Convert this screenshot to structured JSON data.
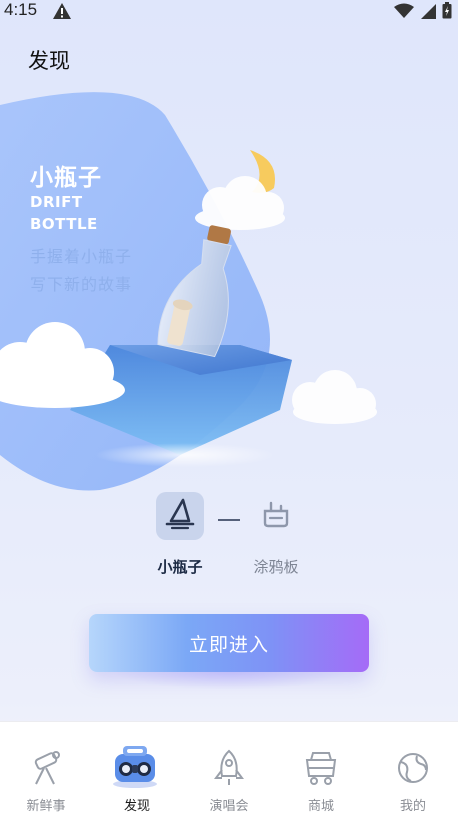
{
  "status_bar": {
    "time": "4:15",
    "icons": [
      "warning-icon",
      "wifi-icon",
      "signal-icon",
      "battery-icon"
    ]
  },
  "page": {
    "title": "发现"
  },
  "hero": {
    "title": "小瓶子",
    "en_line1": "DRIFT",
    "en_line2": "BOTTLE",
    "subtitle_line1": "手握着小瓶子",
    "subtitle_line2": "写下新的故事",
    "colors": {
      "blob": "#9fbdfa",
      "subtitle": "#8fb0ec"
    }
  },
  "modes": {
    "items": [
      {
        "label": "小瓶子",
        "icon": "bottle-sail-icon",
        "selected": true
      },
      {
        "label": "涂鸦板",
        "icon": "paint-brush-icon",
        "selected": false
      }
    ]
  },
  "enter_button": {
    "label": "立即进入"
  },
  "tab_bar": {
    "items": [
      {
        "label": "新鲜事",
        "icon": "telescope-icon",
        "active": false
      },
      {
        "label": "发现",
        "icon": "radio-robot-icon",
        "active": true
      },
      {
        "label": "演唱会",
        "icon": "rocket-icon",
        "active": false
      },
      {
        "label": "商城",
        "icon": "cart-icon",
        "active": false
      },
      {
        "label": "我的",
        "icon": "planet-icon",
        "active": false
      }
    ]
  },
  "colors": {
    "accent_start": "#b6d6fb",
    "accent_end": "#a56bf7",
    "tab_active": "#1a1a1a",
    "tab_inactive": "#8a8d94"
  }
}
